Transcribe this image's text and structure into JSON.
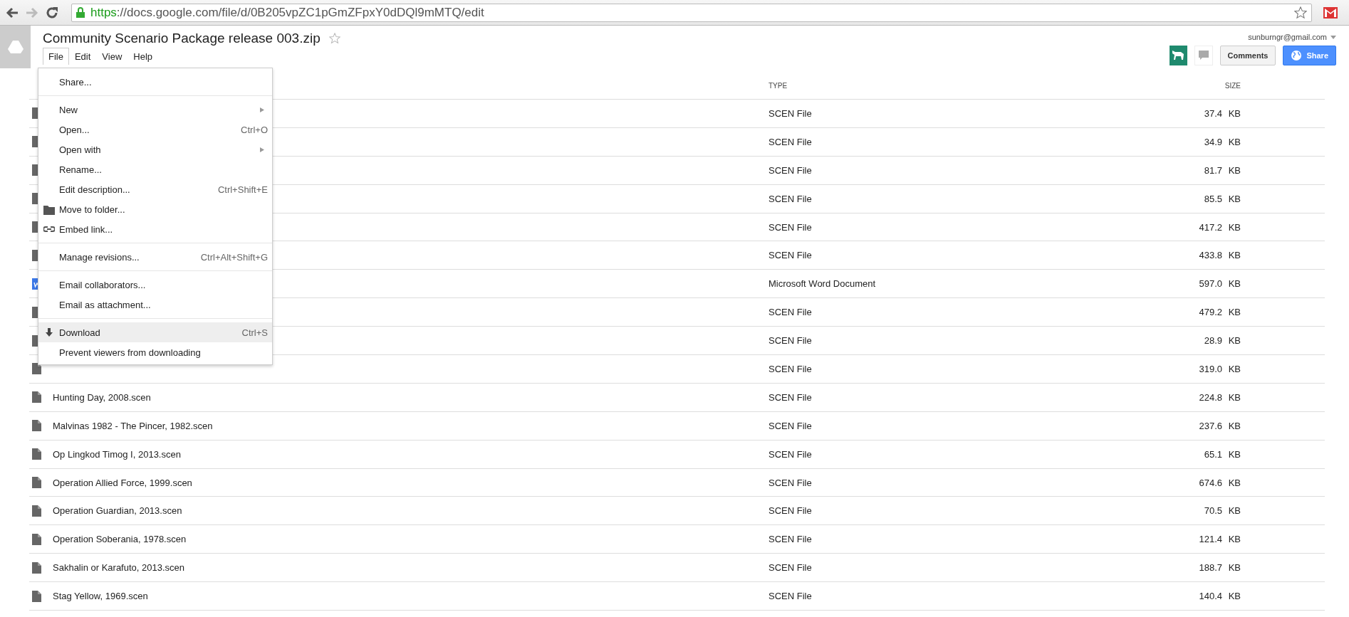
{
  "browser": {
    "url_scheme": "https",
    "url_rest": "://docs.google.com/file/d/0B205vpZC1pGmZFpxY0dDQl9mMTQ/edit"
  },
  "document": {
    "title": "Community Scenario Package release 003.zip",
    "starred": false
  },
  "menubar": [
    {
      "label": "File",
      "selected": true
    },
    {
      "label": "Edit",
      "selected": false
    },
    {
      "label": "View",
      "selected": false
    },
    {
      "label": "Help",
      "selected": false
    }
  ],
  "account": {
    "email": "sunburngr@gmail.com"
  },
  "actions": {
    "comments": "Comments",
    "share": "Share"
  },
  "file_menu": [
    {
      "kind": "item",
      "label": "Share...",
      "selected": false
    },
    {
      "kind": "separator"
    },
    {
      "kind": "item",
      "label": "New",
      "submenu": true,
      "selected": false
    },
    {
      "kind": "item",
      "label": "Open...",
      "shortcut": "Ctrl+O",
      "selected": false
    },
    {
      "kind": "item",
      "label": "Open with",
      "submenu": true,
      "selected": false
    },
    {
      "kind": "item",
      "label": "Rename...",
      "selected": false
    },
    {
      "kind": "item",
      "label": "Edit description...",
      "shortcut": "Ctrl+Shift+E",
      "selected": false
    },
    {
      "kind": "folder",
      "label": "Move to folder...",
      "selected": false
    },
    {
      "kind": "link",
      "label": "Embed link...",
      "selected": false
    },
    {
      "kind": "separator"
    },
    {
      "kind": "item",
      "label": "Manage revisions...",
      "shortcut": "Ctrl+Alt+Shift+G",
      "selected": false
    },
    {
      "kind": "separator"
    },
    {
      "kind": "item",
      "label": "Email collaborators...",
      "selected": false
    },
    {
      "kind": "item",
      "label": "Email as attachment...",
      "selected": false
    },
    {
      "kind": "separator"
    },
    {
      "kind": "download",
      "label": "Download",
      "shortcut": "Ctrl+S",
      "selected": true
    },
    {
      "kind": "item",
      "label": "Prevent viewers from downloading",
      "selected": false
    }
  ],
  "table": {
    "columns": [
      "TYPE",
      "SIZE"
    ],
    "rows": [
      {
        "kind": "file",
        "type": "SCEN File",
        "size": "37.4 KB"
      },
      {
        "kind": "file",
        "type": "SCEN File",
        "size": "34.9 KB"
      },
      {
        "kind": "file",
        "type": "SCEN File",
        "size": "81.7 KB"
      },
      {
        "kind": "file",
        "type": "SCEN File",
        "size": "85.5 KB"
      },
      {
        "kind": "file",
        "type": "SCEN File",
        "size": "417.2 KB"
      },
      {
        "kind": "file",
        "type": "SCEN File",
        "size": "433.8 KB"
      },
      {
        "kind": "word",
        "type": "Microsoft Word Document",
        "size": "597.0 KB"
      },
      {
        "kind": "file",
        "type": "SCEN File",
        "size": "479.2 KB"
      },
      {
        "kind": "file",
        "type": "SCEN File",
        "size": "28.9 KB"
      },
      {
        "kind": "file",
        "type": "SCEN File",
        "size": "319.0 KB"
      },
      {
        "kind": "file",
        "name": "Hunting Day, 2008.scen",
        "type": "SCEN File",
        "size": "224.8 KB"
      },
      {
        "kind": "file",
        "name": "Malvinas 1982 - The Pincer, 1982.scen",
        "type": "SCEN File",
        "size": "237.6 KB"
      },
      {
        "kind": "file",
        "name": "Op Lingkod Timog I, 2013.scen",
        "type": "SCEN File",
        "size": "65.1 KB"
      },
      {
        "kind": "file",
        "name": "Operation Allied Force, 1999.scen",
        "type": "SCEN File",
        "size": "674.6 KB"
      },
      {
        "kind": "file",
        "name": "Operation Guardian, 2013.scen",
        "type": "SCEN File",
        "size": "70.5 KB"
      },
      {
        "kind": "file",
        "name": "Operation Soberania, 1978.scen",
        "type": "SCEN File",
        "size": "121.4 KB"
      },
      {
        "kind": "file",
        "name": "Sakhalin or Karafuto, 2013.scen",
        "type": "SCEN File",
        "size": "188.7 KB"
      },
      {
        "kind": "file",
        "name": "Stag Yellow, 1969.scen",
        "type": "SCEN File",
        "size": "140.4 KB"
      }
    ]
  }
}
